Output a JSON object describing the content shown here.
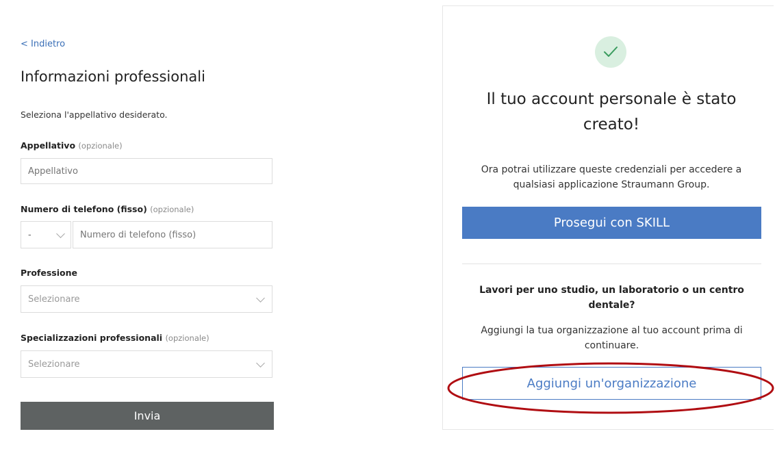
{
  "form": {
    "back_link": "< Indietro",
    "title": "Informazioni professionali",
    "subtitle": "Seleziona l'appellativo desiderato.",
    "appellativo": {
      "label": "Appellativo",
      "optional": "(opzionale)",
      "placeholder": "Appellativo"
    },
    "phone": {
      "label": "Numero di telefono (fisso)",
      "optional": "(opzionale)",
      "prefix_value": "-",
      "placeholder": "Numero di telefono (fisso)"
    },
    "profession": {
      "label": "Professione",
      "placeholder": "Selezionare"
    },
    "specializations": {
      "label": "Specializzazioni professionali",
      "optional": "(opzionale)",
      "placeholder": "Selezionare"
    },
    "submit_label": "Invia"
  },
  "success": {
    "title": "Il tuo account personale è stato creato!",
    "description": "Ora potrai utilizzare queste credenziali per accedere a qualsiasi applicazione Straumann Group.",
    "continue_label": "Prosegui con SKILL",
    "org_question": "Lavori per uno studio, un laboratorio o un centro dentale?",
    "org_hint": "Aggiungi la tua organizzazione al tuo account prima di continuare.",
    "add_org_label": "Aggiungi un'organizzazione"
  },
  "colors": {
    "accent": "#4a7bc4",
    "submit_bg": "#5e6262",
    "success_circle": "#d9efe0",
    "annotation": "#b00d12"
  },
  "icons": [
    "chevron-down-icon",
    "check-icon"
  ]
}
